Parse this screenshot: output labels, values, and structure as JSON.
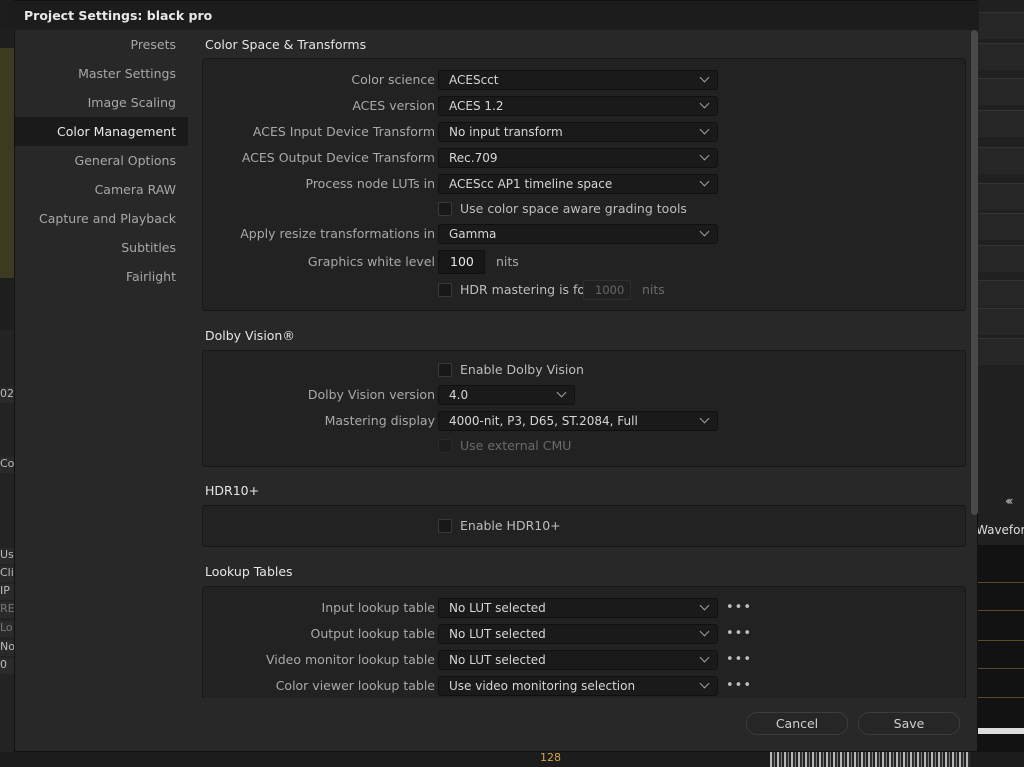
{
  "window": {
    "title": "Project Settings:  black pro"
  },
  "sidebar": {
    "items": [
      {
        "label": "Presets"
      },
      {
        "label": "Master Settings"
      },
      {
        "label": "Image Scaling"
      },
      {
        "label": "Color Management",
        "active": true
      },
      {
        "label": "General Options"
      },
      {
        "label": "Camera RAW"
      },
      {
        "label": "Capture and Playback"
      },
      {
        "label": "Subtitles"
      },
      {
        "label": "Fairlight"
      }
    ]
  },
  "color_space": {
    "title": "Color Space & Transforms",
    "color_science": {
      "label": "Color science",
      "value": "ACEScct"
    },
    "aces_version": {
      "label": "ACES version",
      "value": "ACES 1.2"
    },
    "aces_idt": {
      "label": "ACES Input Device Transform",
      "value": "No input transform"
    },
    "aces_odt": {
      "label": "ACES Output Device Transform",
      "value": "Rec.709"
    },
    "process_luts": {
      "label": "Process node LUTs in",
      "value": "ACEScc AP1 timeline space"
    },
    "grading_tools": {
      "label": "Use color space aware grading tools",
      "checked": false
    },
    "resize": {
      "label": "Apply resize transformations in",
      "value": "Gamma"
    },
    "white_level": {
      "label": "Graphics white level",
      "value": "100",
      "unit": "nits"
    },
    "hdr_mastering": {
      "label": "HDR mastering is for",
      "value": "1000",
      "unit": "nits",
      "checked": false
    }
  },
  "dolby": {
    "title": "Dolby Vision®",
    "enable": {
      "label": "Enable Dolby Vision",
      "checked": false
    },
    "version": {
      "label": "Dolby Vision version",
      "value": "4.0"
    },
    "mastering": {
      "label": "Mastering display",
      "value": "4000-nit, P3, D65, ST.2084, Full"
    },
    "external_cmu": {
      "label": "Use external CMU",
      "checked": false
    }
  },
  "hdr10": {
    "title": "HDR10+",
    "enable": {
      "label": "Enable HDR10+",
      "checked": false
    }
  },
  "luts": {
    "title": "Lookup Tables",
    "input": {
      "label": "Input lookup table",
      "value": "No LUT selected"
    },
    "output": {
      "label": "Output lookup table",
      "value": "No LUT selected"
    },
    "video_monitor": {
      "label": "Video monitor lookup table",
      "value": "No LUT selected"
    },
    "color_viewer": {
      "label": "Color viewer lookup table",
      "value": "Use video monitoring selection"
    },
    "more": "•••"
  },
  "footer": {
    "cancel": "Cancel",
    "save": "Save"
  },
  "background": {
    "left_labels": [
      "02",
      "Cor",
      "Us",
      "Cli",
      "IP",
      "RE",
      "Lo",
      "No",
      "0"
    ],
    "waveform_label": "Waveform",
    "readout": "128"
  },
  "colors": {
    "dialog_bg": "#282828",
    "panel_bg": "#222222",
    "active_item_bg": "#1a1a1a",
    "accent": "#d3a44a"
  }
}
